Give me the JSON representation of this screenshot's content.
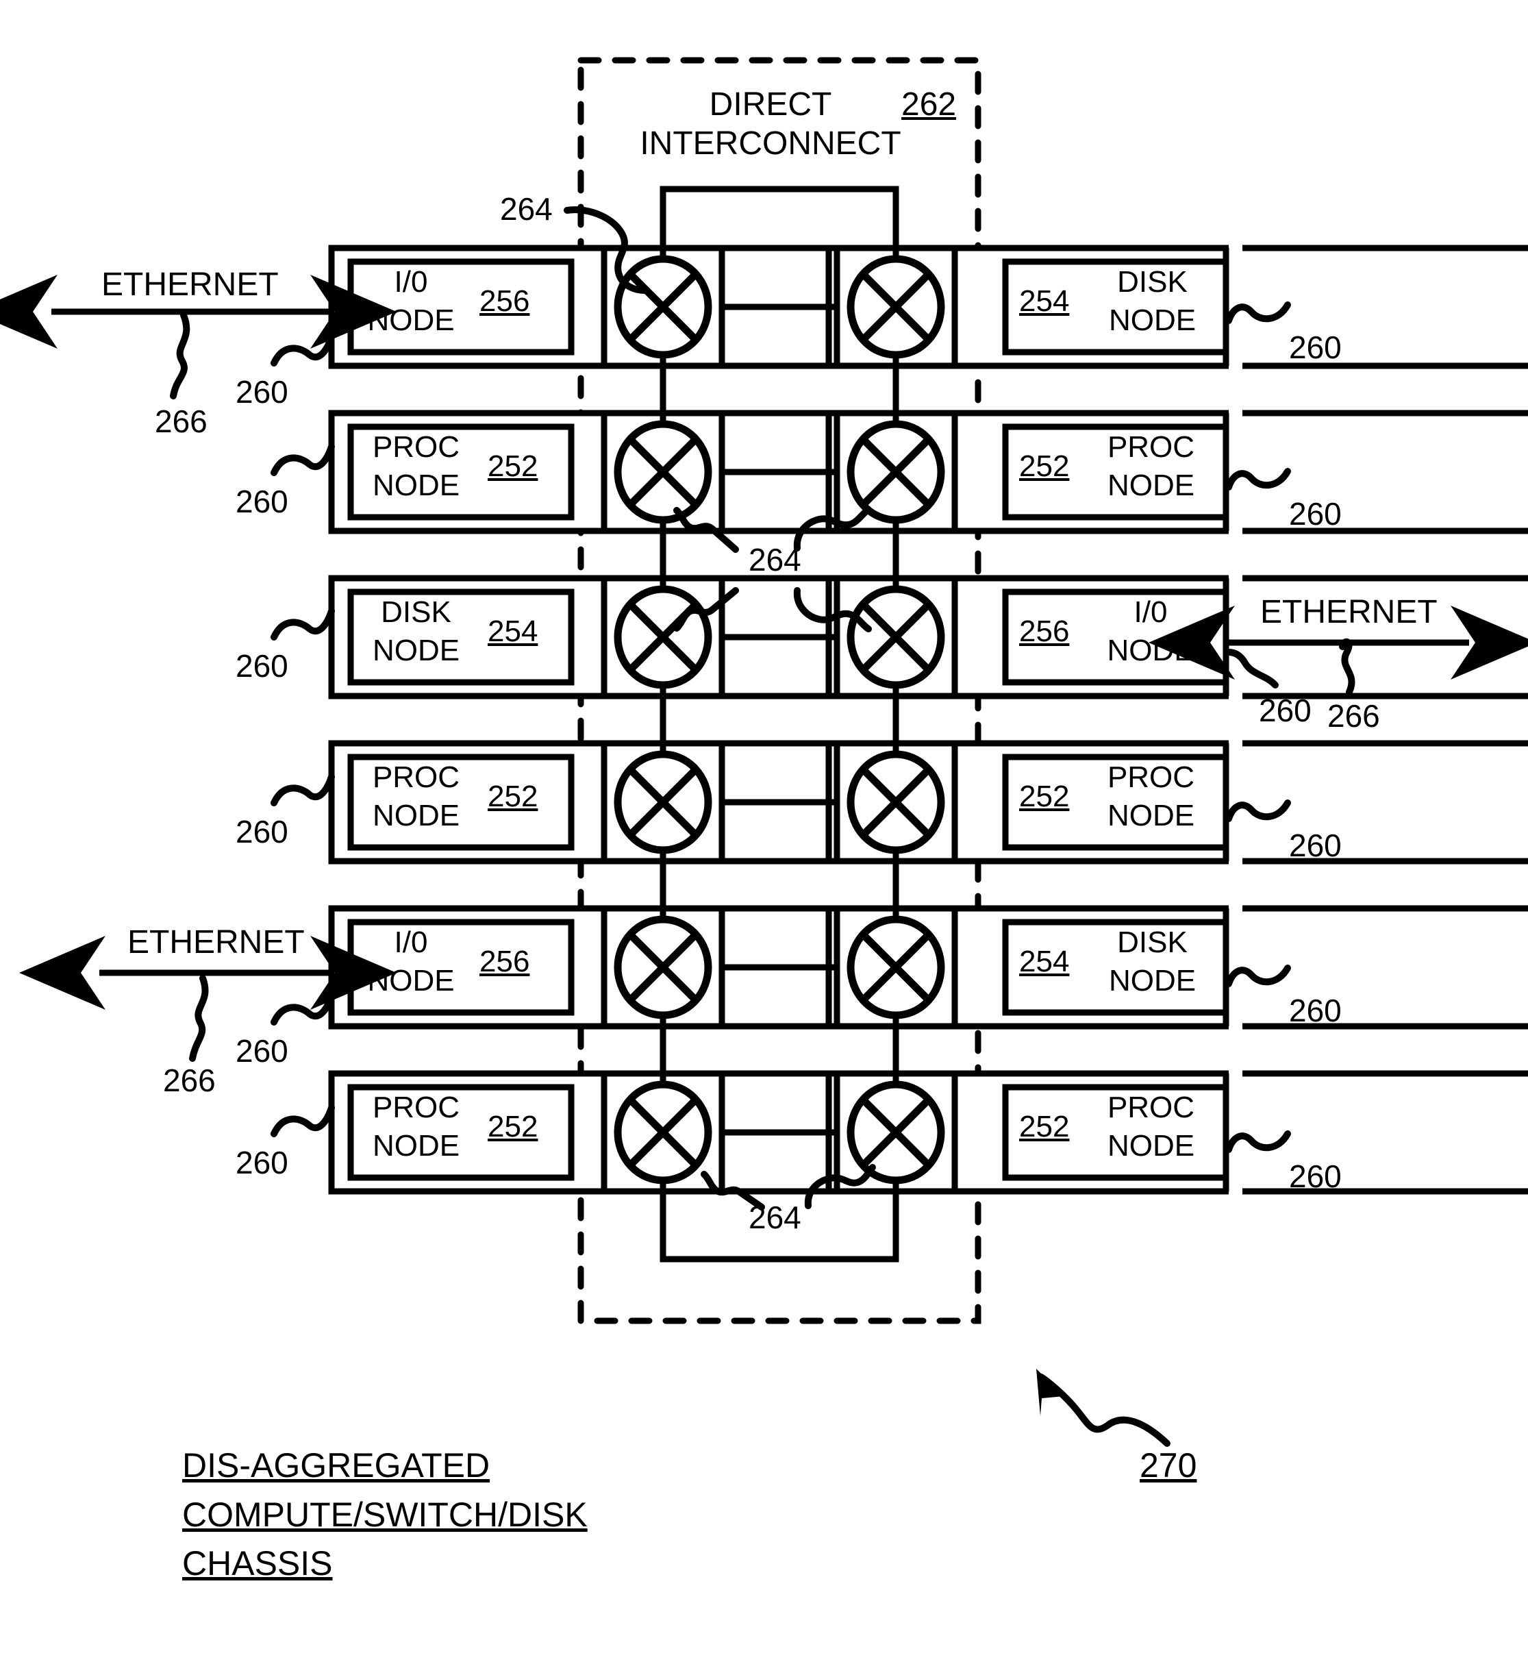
{
  "figure": {
    "ref_number": "270",
    "caption_lines": [
      "DIS-AGGREGATED",
      "COMPUTE/SWITCH/DISK",
      "CHASSIS"
    ]
  },
  "interconnect": {
    "title_line1": "DIRECT",
    "title_line2": "INTERCONNECT",
    "ref": "262",
    "link_ref": "264",
    "link_refs": [
      "264",
      "264",
      "264"
    ]
  },
  "labels": {
    "ethernet": "ETHERNET",
    "chassis_ref": "260",
    "ethernet_ref": "266"
  },
  "nodes": {
    "proc_name_line1": "PROC",
    "proc_name_line2": "NODE",
    "proc_ref": "252",
    "disk_name_line1": "DISK",
    "disk_name_line2": "NODE",
    "disk_ref": "254",
    "io_name_line1": "I/0",
    "io_name_line2": "NODE",
    "io_ref": "256"
  },
  "rows": [
    {
      "index": 1,
      "left": {
        "type": "io",
        "line1": "I/0",
        "line2": "NODE",
        "ref": "256",
        "ref_side": "right",
        "ethernet": true,
        "chassis_ref": "260",
        "ethernet_ref": "266"
      },
      "right": {
        "type": "disk",
        "line1": "DISK",
        "line2": "NODE",
        "ref": "254",
        "ref_side": "left",
        "ethernet": false,
        "chassis_ref": "260"
      }
    },
    {
      "index": 2,
      "left": {
        "type": "proc",
        "line1": "PROC",
        "line2": "NODE",
        "ref": "252",
        "ref_side": "right",
        "ethernet": false,
        "chassis_ref": "260"
      },
      "right": {
        "type": "proc",
        "line1": "PROC",
        "line2": "NODE",
        "ref": "252",
        "ref_side": "left",
        "ethernet": false,
        "chassis_ref": "260"
      }
    },
    {
      "index": 3,
      "left": {
        "type": "disk",
        "line1": "DISK",
        "line2": "NODE",
        "ref": "254",
        "ref_side": "right",
        "ethernet": false,
        "chassis_ref": "260"
      },
      "right": {
        "type": "io",
        "line1": "I/0",
        "line2": "NODE",
        "ref": "256",
        "ref_side": "left",
        "ethernet": true,
        "chassis_ref": "260",
        "ethernet_ref": "266"
      }
    },
    {
      "index": 4,
      "left": {
        "type": "proc",
        "line1": "PROC",
        "line2": "NODE",
        "ref": "252",
        "ref_side": "right",
        "ethernet": false,
        "chassis_ref": "260"
      },
      "right": {
        "type": "proc",
        "line1": "PROC",
        "line2": "NODE",
        "ref": "252",
        "ref_side": "left",
        "ethernet": false,
        "chassis_ref": "260"
      }
    },
    {
      "index": 5,
      "left": {
        "type": "io",
        "line1": "I/0",
        "line2": "NODE",
        "ref": "256",
        "ref_side": "right",
        "ethernet": true,
        "chassis_ref": "260",
        "ethernet_ref": "266"
      },
      "right": {
        "type": "disk",
        "line1": "DISK",
        "line2": "NODE",
        "ref": "254",
        "ref_side": "left",
        "ethernet": false,
        "chassis_ref": "260"
      }
    },
    {
      "index": 6,
      "left": {
        "type": "proc",
        "line1": "PROC",
        "line2": "NODE",
        "ref": "252",
        "ref_side": "right",
        "ethernet": false,
        "chassis_ref": "260"
      },
      "right": {
        "type": "proc",
        "line1": "PROC",
        "line2": "NODE",
        "ref": "252",
        "ref_side": "left",
        "ethernet": false,
        "chassis_ref": "260"
      }
    }
  ],
  "colors": {
    "ink": "#000000",
    "paper": "#ffffff"
  }
}
